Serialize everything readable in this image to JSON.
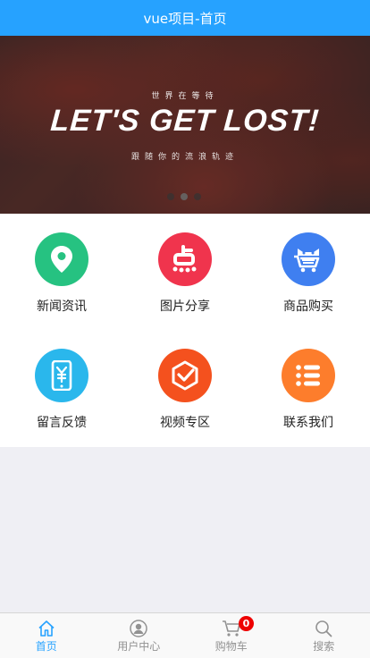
{
  "header": {
    "title": "vue项目-首页"
  },
  "banner": {
    "small_text": "世界在等待",
    "headline": "LET'S GET LOST!",
    "sub_text": "跟随你的流浪轨迹",
    "slide_count": 3,
    "active_slide": 2
  },
  "grid": {
    "items": [
      {
        "label": "新闻资讯",
        "icon": "location-pin-icon",
        "color": "#26c281"
      },
      {
        "label": "图片分享",
        "icon": "dianping-icon",
        "color": "#f0344d"
      },
      {
        "label": "商品购买",
        "icon": "cart-cat-icon",
        "color": "#3f7ff0"
      },
      {
        "label": "留言反馈",
        "icon": "phone-yuan-icon",
        "color": "#2ab7ec"
      },
      {
        "label": "视频专区",
        "icon": "check-hexagon-icon",
        "color": "#f4511e"
      },
      {
        "label": "联系我们",
        "icon": "list-icon",
        "color": "#fd7d2c"
      }
    ]
  },
  "tabbar": {
    "items": [
      {
        "label": "首页",
        "icon": "home-icon",
        "active": true
      },
      {
        "label": "用户中心",
        "icon": "user-icon",
        "active": false
      },
      {
        "label": "购物车",
        "icon": "cart-icon",
        "active": false,
        "badge": "0"
      },
      {
        "label": "搜索",
        "icon": "search-icon",
        "active": false
      }
    ]
  },
  "colors": {
    "primary": "#26a2ff",
    "badge": "#e00000"
  }
}
